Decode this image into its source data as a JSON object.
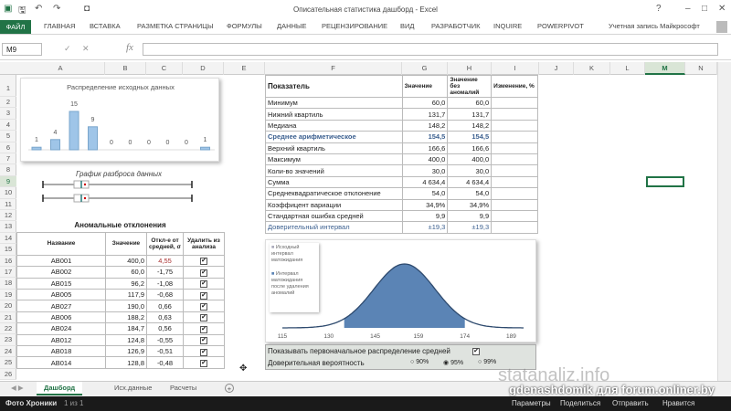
{
  "window": {
    "title": "Описательная статистика дашборд - Excel",
    "help": "?",
    "min": "–",
    "max": "□",
    "close": "✕"
  },
  "ribbon": {
    "file": "ФАЙЛ",
    "tabs": [
      "ГЛАВНАЯ",
      "ВСТАВКА",
      "РАЗМЕТКА СТРАНИЦЫ",
      "ФОРМУЛЫ",
      "ДАННЫЕ",
      "РЕЦЕНЗИРОВАНИЕ",
      "ВИД",
      "РАЗРАБОТЧИК",
      "INQUIRE",
      "POWERPIVOT"
    ],
    "account": "Учетная запись Майкрософт"
  },
  "formula_bar": {
    "name_box": "M9",
    "fx": "fx",
    "value": ""
  },
  "columns": [
    "A",
    "B",
    "C",
    "D",
    "E",
    "F",
    "G",
    "H",
    "I",
    "J",
    "K",
    "L",
    "M",
    "N"
  ],
  "selected_cell": "M9",
  "histogram": {
    "title": "Распределение исходных данных",
    "chart_data": {
      "type": "bar",
      "title": "Распределение исходных данных",
      "values": [
        1,
        4,
        15,
        9,
        0,
        0,
        0,
        0,
        0,
        1
      ],
      "color": "#9fc5e8"
    }
  },
  "scatter_title": "График разброса данных",
  "anomalies": {
    "title": "Аномальные отклонения",
    "headers": [
      "Название",
      "Значение",
      "Откл-е от средней, σ",
      "Удалить из анализа"
    ],
    "rows": [
      [
        "AB001",
        "400,0",
        "4,55"
      ],
      [
        "AB002",
        "60,0",
        "-1,75"
      ],
      [
        "AB015",
        "96,2",
        "-1,08"
      ],
      [
        "AB005",
        "117,9",
        "-0,68"
      ],
      [
        "AB027",
        "190,0",
        "0,66"
      ],
      [
        "AB006",
        "188,2",
        "0,63"
      ],
      [
        "AB024",
        "184,7",
        "0,56"
      ],
      [
        "AB012",
        "124,8",
        "-0,55"
      ],
      [
        "AB018",
        "126,9",
        "-0,51"
      ],
      [
        "AB014",
        "128,8",
        "-0,48"
      ]
    ],
    "checked": true
  },
  "stats": {
    "headers": [
      "Показатель",
      "Значение",
      "Значение без аномалий",
      "Изменение, %"
    ],
    "rows": [
      [
        "Минимум",
        "60,0",
        "60,0"
      ],
      [
        "Нижний квартиль",
        "131,7",
        "131,7"
      ],
      [
        "Медиана",
        "148,2",
        "148,2"
      ],
      [
        "Среднее арифметическое",
        "154,5",
        "154,5"
      ],
      [
        "Верхний квартиль",
        "166,6",
        "166,6"
      ],
      [
        "Максимум",
        "400,0",
        "400,0"
      ],
      [
        "Коли-во значений",
        "30,0",
        "30,0"
      ],
      [
        "Сумма",
        "4 634,4",
        "4 634,4"
      ],
      [
        "Среднеквадратическое отклонение",
        "54,0",
        "54,0"
      ],
      [
        "Коэффицент вариации",
        "34,9%",
        "34,9%"
      ],
      [
        "Стандартная ошибка средней",
        "9,9",
        "9,9"
      ],
      [
        "Доверительный интервал",
        "±19,3",
        "±19,3"
      ]
    ]
  },
  "normal_chart": {
    "legend": [
      "Исходный интервал матожидания",
      "Интервал матожидания после удаления аномалий"
    ],
    "x_ticks": [
      "115",
      "130",
      "145",
      "159",
      "174",
      "189"
    ],
    "chart_data": {
      "type": "area",
      "mean": 154.5,
      "std_error": 9.9,
      "shaded_range": [
        135,
        174
      ],
      "xlim": [
        115,
        193
      ],
      "color": "#5b84b5"
    }
  },
  "controls": {
    "show_original": "Показывать первоначальное распределение средней",
    "show_original_checked": true,
    "confidence_label": "Доверительная вероятность",
    "options": [
      "90%",
      "95%",
      "99%"
    ],
    "selected": "95%"
  },
  "sheets": [
    "Дашборд",
    "Исх.данные",
    "Расчеты"
  ],
  "add_sheet": "+",
  "overlay": {
    "watermark": "statanaliz.info",
    "caption": "gdenashdomik для forum.onliner.by",
    "left": "Фото Хроники",
    "count": "1 из 1",
    "actions": [
      "Параметры",
      "Поделиться",
      "Отправить",
      "Нравится"
    ]
  }
}
